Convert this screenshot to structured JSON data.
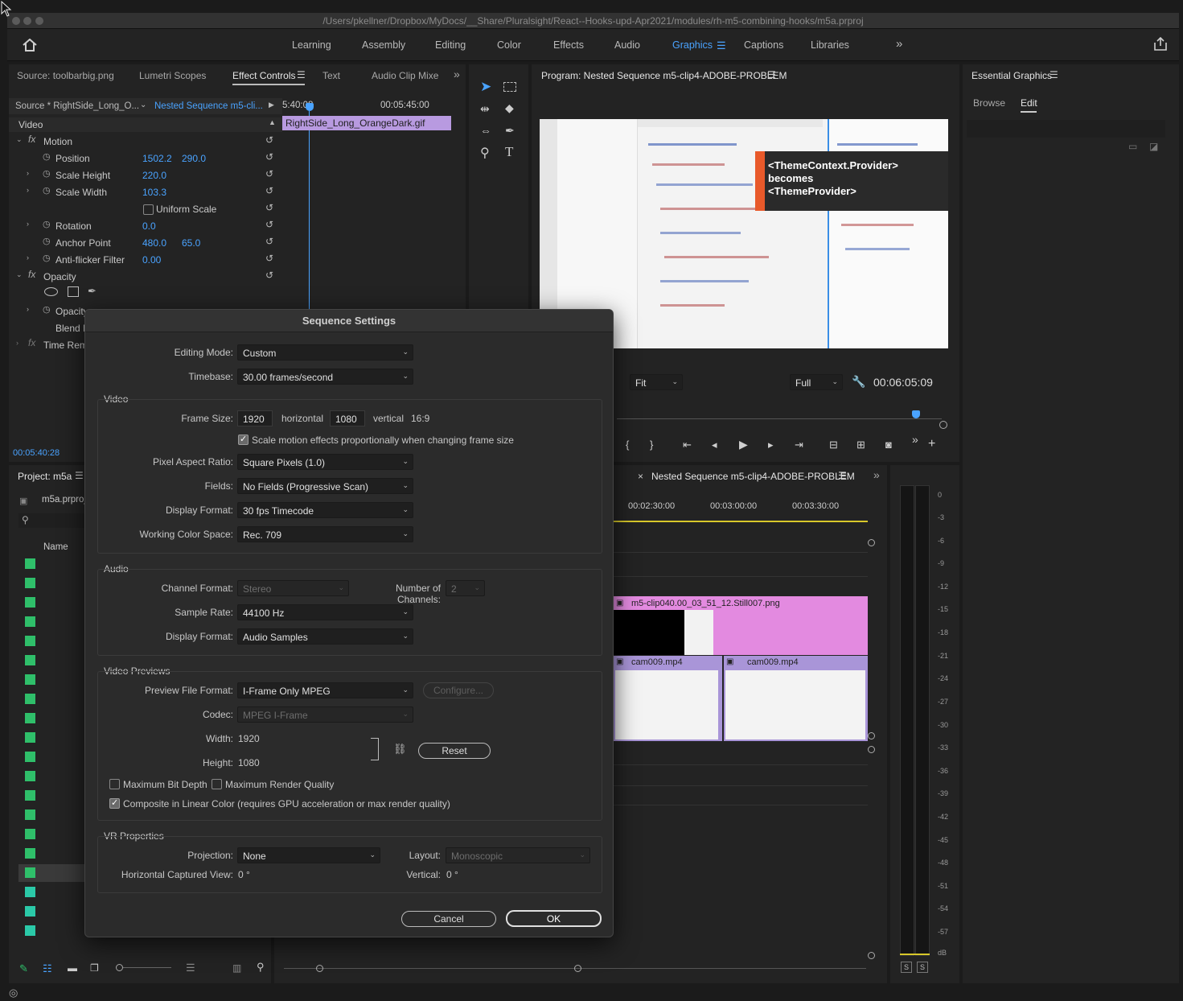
{
  "window": {
    "path": "/Users/pkellner/Dropbox/MyDocs/__Share/Pluralsight/React--Hooks-upd-Apr2021/modules/rh-m5-combining-hooks/m5a.prproj"
  },
  "workspaces": [
    "Learning",
    "Assembly",
    "Editing",
    "Color",
    "Effects",
    "Audio",
    "Graphics",
    "Captions",
    "Libraries"
  ],
  "active_workspace": "Graphics",
  "source_panel": {
    "tabs": [
      "Source: toolbarbig.png",
      "Lumetri Scopes",
      "Effect Controls",
      "Text",
      "Audio Clip Mixe"
    ],
    "active_tab": "Effect Controls",
    "source_label": "Source * RightSide_Long_O...",
    "sequence_label": "Nested Sequence m5-cli...",
    "time_start": "5:40:08",
    "time_end": "00:05:45:00",
    "clip_name": "RightSide_Long_OrangeDark.gif",
    "section_video": "Video",
    "motion": "Motion",
    "position_label": "Position",
    "position_x": "1502.2",
    "position_y": "290.0",
    "scale_height_label": "Scale Height",
    "scale_height": "220.0",
    "scale_width_label": "Scale Width",
    "scale_width": "103.3",
    "uniform_scale": "Uniform Scale",
    "rotation_label": "Rotation",
    "rotation": "0.0",
    "anchor_label": "Anchor Point",
    "anchor_x": "480.0",
    "anchor_y": "65.0",
    "antiflicker_label": "Anti-flicker Filter",
    "antiflicker": "0.00",
    "opacity_section": "Opacity",
    "opacity_label": "Opacity",
    "blend_label": "Blend M",
    "time_remap": "Time Rem",
    "current_time": "00:05:40:28"
  },
  "program_monitor": {
    "title": "Program: Nested Sequence m5-clip4-ADOBE-PROBLEM",
    "callout_line1": "<ThemeContext.Provider>",
    "callout_line2": "becomes",
    "callout_line3": "<ThemeProvider>",
    "zoom": "Fit",
    "quality": "Full",
    "timecode": "00:06:05:09"
  },
  "essential_graphics": {
    "title": "Essential Graphics",
    "tabs": [
      "Browse",
      "Edit"
    ],
    "active_tab": "Edit"
  },
  "project": {
    "title": "Project: m5a",
    "file": "m5a.prproj",
    "column_name": "Name"
  },
  "timeline": {
    "title": "Nested Sequence m5-clip4-ADOBE-PROBLEM",
    "ruler": [
      "00:02:30:00",
      "00:03:00:00",
      "00:03:30:00"
    ],
    "clip_still": "m5-clip040.00_03_51_12.Still007.png",
    "clip_cam_a": "cam009.mp4",
    "clip_cam_b": "cam009.mp4"
  },
  "meter": {
    "labels": [
      "0",
      "-3",
      "-6",
      "-9",
      "-12",
      "-15",
      "-18",
      "-21",
      "-24",
      "-27",
      "-30",
      "-33",
      "-36",
      "-39",
      "-42",
      "-45",
      "-48",
      "-51",
      "-54",
      "-57",
      "dB"
    ],
    "solo_a": "S",
    "solo_b": "S"
  },
  "dialog": {
    "title": "Sequence Settings",
    "editing_mode_label": "Editing Mode:",
    "editing_mode": "Custom",
    "timebase_label": "Timebase:",
    "timebase": "30.00  frames/second",
    "video_group": "Video",
    "frame_size_label": "Frame Size:",
    "frame_w": "1920",
    "horizontal": "horizontal",
    "frame_h": "1080",
    "vertical": "vertical",
    "aspect": "16:9",
    "scale_motion": "Scale motion effects proportionally when changing frame size",
    "par_label": "Pixel Aspect Ratio:",
    "par": "Square Pixels (1.0)",
    "fields_label": "Fields:",
    "fields": "No Fields (Progressive Scan)",
    "vdisplay_label": "Display Format:",
    "vdisplay": "30 fps Timecode",
    "colorspace_label": "Working Color Space:",
    "colorspace": "Rec. 709",
    "audio_group": "Audio",
    "channel_label": "Channel Format:",
    "channel": "Stereo",
    "numch_label": "Number of Channels:",
    "numch": "2",
    "samplerate_label": "Sample Rate:",
    "samplerate": "44100 Hz",
    "adisplay_label": "Display Format:",
    "adisplay": "Audio Samples",
    "previews_group": "Video Previews",
    "pff_label": "Preview File Format:",
    "pff": "I-Frame Only MPEG",
    "configure": "Configure...",
    "codec_label": "Codec:",
    "codec": "MPEG I-Frame",
    "width_label": "Width:",
    "width": "1920",
    "height_label": "Height:",
    "height": "1080",
    "reset": "Reset",
    "max_bit_depth": "Maximum Bit Depth",
    "max_render": "Maximum Render Quality",
    "composite_linear": "Composite in Linear Color (requires GPU acceleration or max render quality)",
    "vr_group": "VR Properties",
    "projection_label": "Projection:",
    "projection": "None",
    "layout_label": "Layout:",
    "layout": "Monoscopic",
    "hcv_label": "Horizontal Captured View:",
    "hcv": "0 °",
    "vertical_label": "Vertical:",
    "vertical_val": "0 °",
    "cancel": "Cancel",
    "ok": "OK"
  }
}
